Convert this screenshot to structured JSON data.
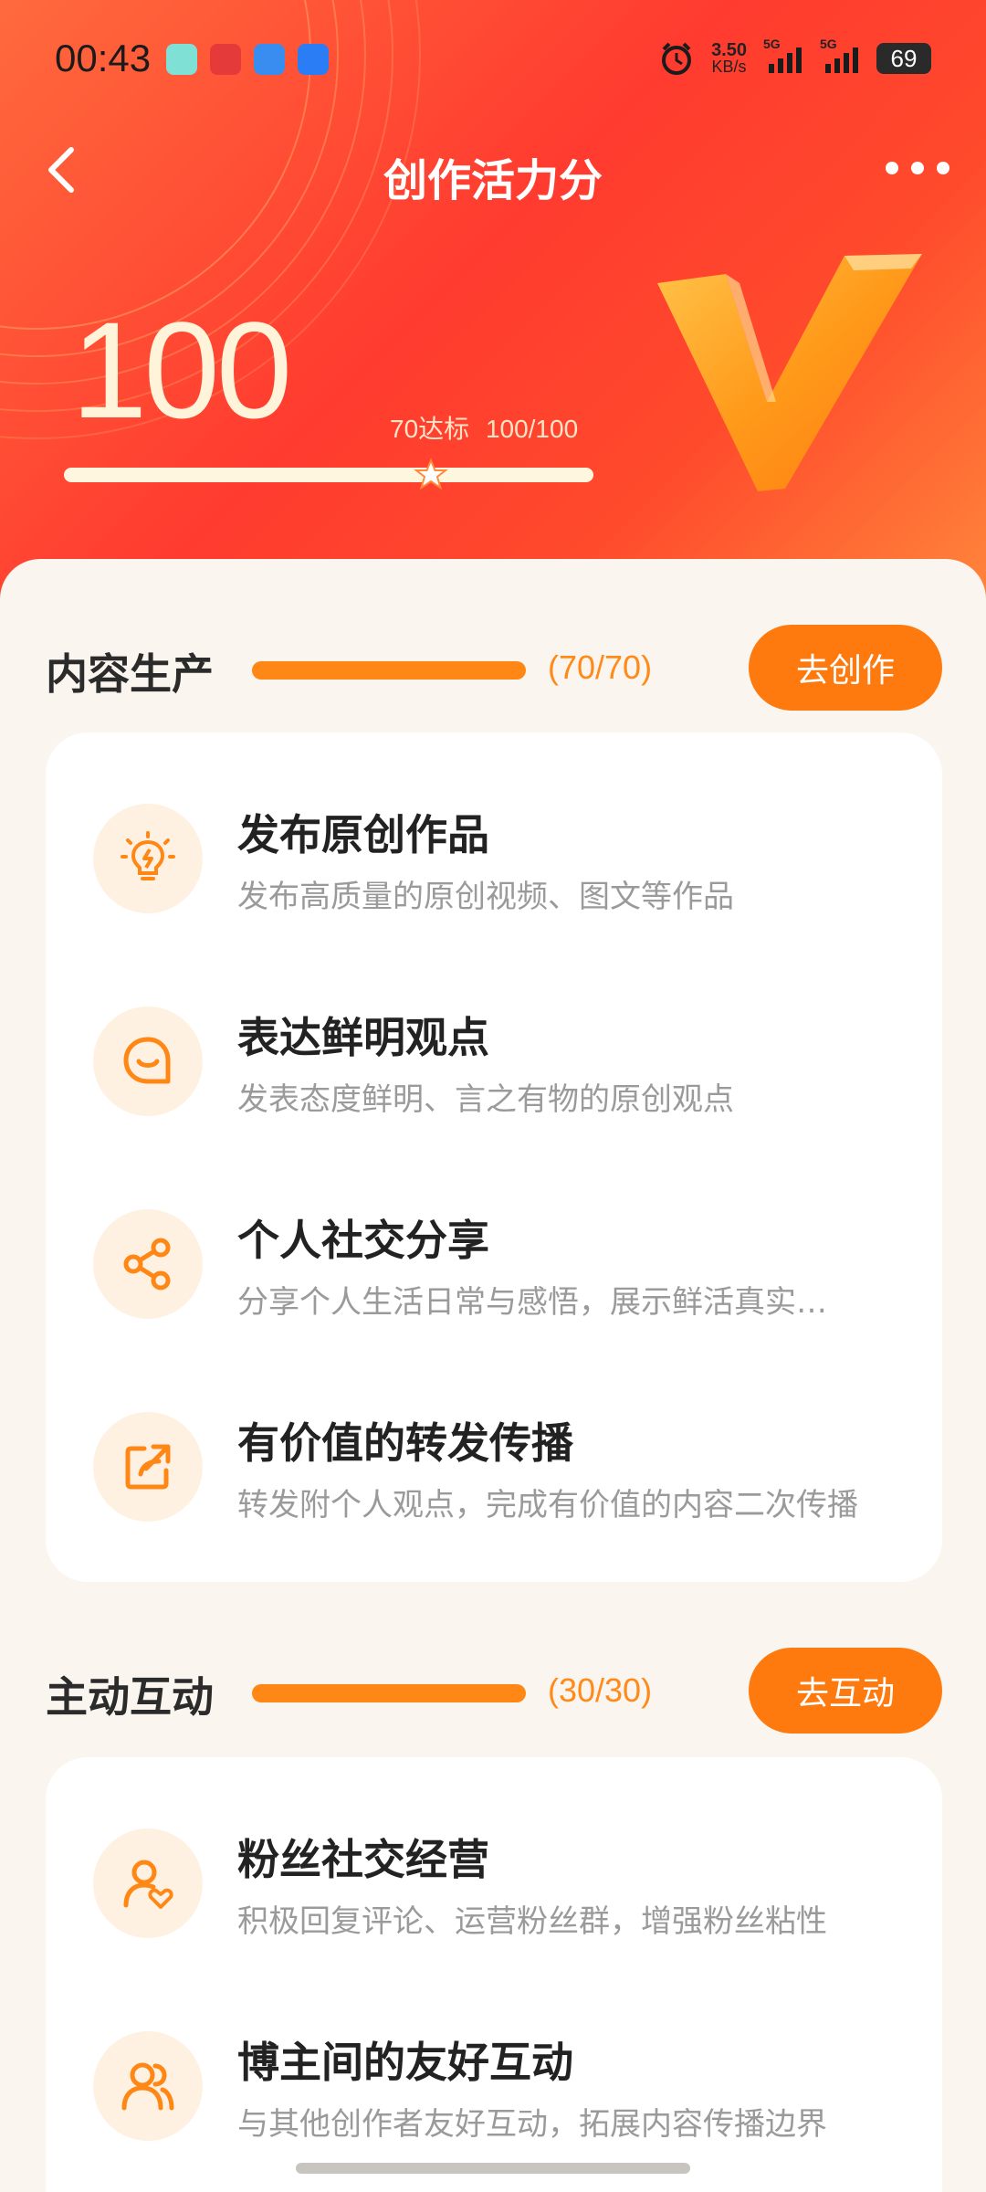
{
  "status_bar": {
    "time": "00:43",
    "net_speed": "3.50",
    "net_unit": "KB/s",
    "sig1": "5G",
    "sig2": "5G",
    "battery": "69"
  },
  "nav": {
    "title": "创作活力分"
  },
  "score": {
    "value": "100",
    "standard": "70达标",
    "progress": "100/100",
    "fraction": 1.0
  },
  "sections": [
    {
      "title": "内容生产",
      "count": "(70/70)",
      "button": "去创作",
      "items": [
        {
          "icon": "lightbulb-icon",
          "title": "发布原创作品",
          "desc": "发布高质量的原创视频、图文等作品"
        },
        {
          "icon": "chat-smile-icon",
          "title": "表达鲜明观点",
          "desc": "发表态度鲜明、言之有物的原创观点"
        },
        {
          "icon": "share-icon",
          "title": "个人社交分享",
          "desc": "分享个人生活日常与感悟，展示鲜活真实…"
        },
        {
          "icon": "forward-icon",
          "title": "有价值的转发传播",
          "desc": "转发附个人观点，完成有价值的内容二次传播"
        }
      ]
    },
    {
      "title": "主动互动",
      "count": "(30/30)",
      "button": "去互动",
      "items": [
        {
          "icon": "user-heart-icon",
          "title": "粉丝社交经营",
          "desc": "积极回复评论、运营粉丝群，增强粉丝粘性"
        },
        {
          "icon": "users-icon",
          "title": "博主间的友好互动",
          "desc": "与其他创作者友好互动，拓展内容传播边界"
        }
      ]
    }
  ],
  "colors": {
    "accent": "#ff7a0e",
    "header_red": "#ff3b2f",
    "score_text": "#fff3d9"
  }
}
